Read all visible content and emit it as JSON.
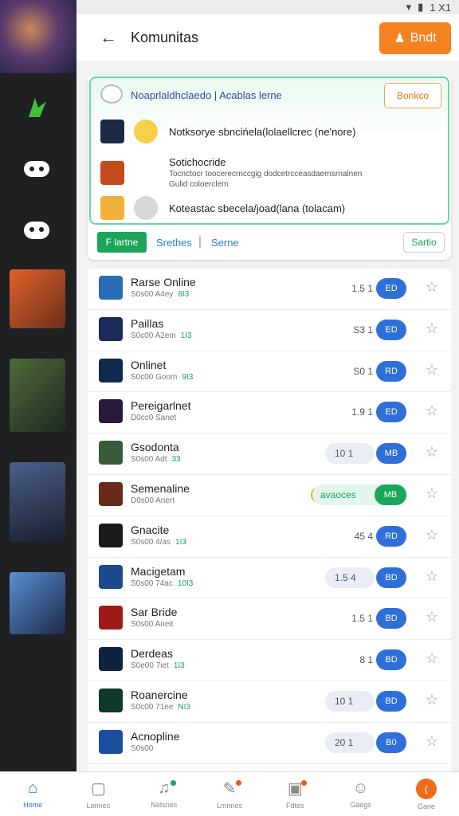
{
  "status": {
    "time": "1 X1"
  },
  "header": {
    "title": "Komunitas",
    "action_label": "Bndt"
  },
  "card": {
    "title": "Noaprlaldhclaedo | Acablas lerne",
    "side_button": "Bonkco",
    "notifications": [
      {
        "text": "Notksorye sbncińela(lolaellcrec (ne'nore)"
      },
      {
        "text": "Sotichocride",
        "sub1": "Tocnctocr toocerecrnccgig dodcetrcceasdaernsrnalnen",
        "sub2": "Gulid coloerclem"
      },
      {
        "text": "Koteastac sbecela/joad(lana (tolacam)"
      }
    ],
    "filters": {
      "active": "F lartne",
      "f1": "Srethes",
      "f2": "Serne",
      "settings": "Sartio"
    }
  },
  "list": [
    {
      "name": "Rarse Online",
      "meta": "S0s00 A4ey",
      "tag": "8I3",
      "count": "1.5 1",
      "action": "ED"
    },
    {
      "name": "Paillas",
      "meta": "S0c00 A2em",
      "tag": "1I3",
      "count": "S3 1",
      "action": "ED"
    },
    {
      "name": "Onlinet",
      "meta": "S0c00 Goom",
      "tag": "9I3",
      "count": "S0 1",
      "action": "RD"
    },
    {
      "name": "Pereigarlnet",
      "meta": "D0cc0 Sanet",
      "tag": "",
      "count": "1.9 1",
      "action": "ED"
    },
    {
      "name": "Gsodonta",
      "meta": "S0s00 Adt",
      "tag": "33",
      "count": "10 1",
      "action": "MB"
    },
    {
      "name": "Semenaline",
      "meta": "D0s00 Anert",
      "tag": "",
      "count": "",
      "action": "MB",
      "green": "avaoces"
    },
    {
      "name": "Gnacite",
      "meta": "S0s00 4/as",
      "tag": "1I3",
      "count": "45 4",
      "action": "RD"
    },
    {
      "name": "Macigetam",
      "meta": "S0s00 74ac",
      "tag": "10I3",
      "count": "1.5 4",
      "action": "BD"
    },
    {
      "name": "Sar Bride",
      "meta": "S0s00 Aneit",
      "tag": "",
      "count": "1.5 1",
      "action": "BD"
    },
    {
      "name": "Derdeas",
      "meta": "S0e00 7iet",
      "tag": "1I3",
      "count": "8 1",
      "action": "BD"
    },
    {
      "name": "Roanercine",
      "meta": "S0c00 71ee",
      "tag": "NI3",
      "count": "10 1",
      "action": "BD"
    },
    {
      "name": "Acnopline",
      "meta": "S0s00",
      "tag": "",
      "count": "20 1",
      "action": "B0"
    }
  ],
  "tabs": [
    {
      "label": "Home",
      "icon": "home-icon"
    },
    {
      "label": "Lonnes",
      "icon": "book-icon"
    },
    {
      "label": "Natsnes",
      "icon": "bell-icon"
    },
    {
      "label": "Lmnnes",
      "icon": "edit-icon"
    },
    {
      "label": "Fdtes",
      "icon": "file-icon"
    },
    {
      "label": "Gaegs",
      "icon": "user-icon"
    },
    {
      "label": "Gane",
      "icon": "game-icon"
    }
  ]
}
